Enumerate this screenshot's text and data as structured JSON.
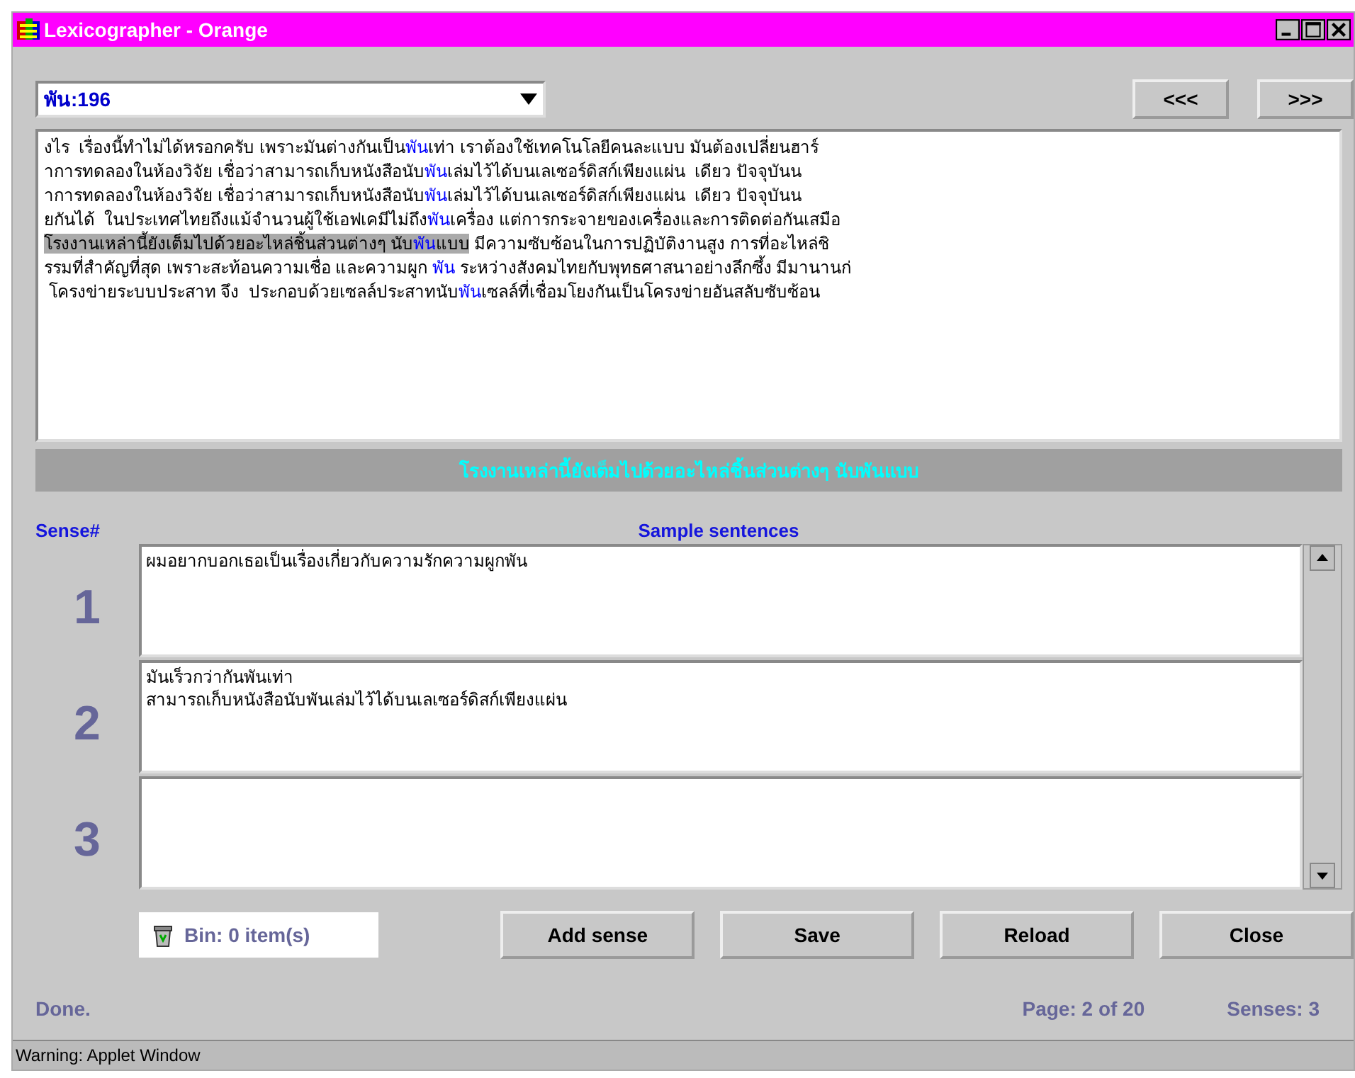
{
  "window": {
    "title": "Lexicographer - Orange"
  },
  "word_selector": {
    "value": "พัน:196"
  },
  "nav_buttons": [
    "<<<",
    ">>>"
  ],
  "concordance": [
    {
      "segments": [
        {
          "text": "งไร  เรื่องนี้ทำไม่ได้หรอกครับ เพราะมันต่างกันเป็น",
          "keyword": false,
          "highlighted": false
        },
        {
          "text": "พัน",
          "keyword": true,
          "highlighted": false
        },
        {
          "text": "เท่า เราต้องใช้เทคโนโลยีคนละแบบ มันต้องเปลี่ยนฮาร์",
          "keyword": false,
          "highlighted": false
        }
      ]
    },
    {
      "segments": [
        {
          "text": "าการทดลองในห้องวิจัย เชื่อว่าสามารถเก็บหนังสือนับ",
          "keyword": false,
          "highlighted": false
        },
        {
          "text": "พัน",
          "keyword": true,
          "highlighted": false
        },
        {
          "text": "เล่มไว้ได้บนเลเซอร์ดิสก์เพียงแผ่น  เดียว ปัจจุบันน",
          "keyword": false,
          "highlighted": false
        }
      ]
    },
    {
      "segments": [
        {
          "text": "าการทดลองในห้องวิจัย เชื่อว่าสามารถเก็บหนังสือนับ",
          "keyword": false,
          "highlighted": false
        },
        {
          "text": "พัน",
          "keyword": true,
          "highlighted": false
        },
        {
          "text": "เล่มไว้ได้บนเลเซอร์ดิสก์เพียงแผ่น  เดียว ปัจจุบันน",
          "keyword": false,
          "highlighted": false
        }
      ]
    },
    {
      "segments": [
        {
          "text": "ยกันได้  ในประเทศไทยถึงแม้จำนวนผู้ใช้เอฟเคมีไม่ถึง",
          "keyword": false,
          "highlighted": false
        },
        {
          "text": "พัน",
          "keyword": true,
          "highlighted": false
        },
        {
          "text": "เครื่อง แต่การกระจายของเครื่องและการติดต่อกันเสมือ",
          "keyword": false,
          "highlighted": false
        }
      ]
    },
    {
      "segments": [
        {
          "text": "โรงงานเหล่านี้ยังเต็มไปด้วยอะไหล่ชิ้นส่วนต่างๆ นับ",
          "keyword": false,
          "highlighted": true
        },
        {
          "text": "พัน",
          "keyword": true,
          "highlighted": true
        },
        {
          "text": "แบบ",
          "keyword": false,
          "highlighted": true
        },
        {
          "text": " มีความซับซ้อนในการปฏิบัติงานสูง การที่อะไหล่ชิ",
          "keyword": false,
          "highlighted": false
        }
      ]
    },
    {
      "segments": [
        {
          "text": "รรมที่สำคัญที่สุด เพราะสะท้อนความเชื่อ และความผูก ",
          "keyword": false,
          "highlighted": false
        },
        {
          "text": "พัน",
          "keyword": true,
          "highlighted": false
        },
        {
          "text": " ระหว่างสังคมไทยกับพุทธศาสนาอย่างลึกซึ้ง มีมานานก่",
          "keyword": false,
          "highlighted": false
        }
      ]
    },
    {
      "segments": [
        {
          "text": " โครงข่ายระบบประสาท จึง  ประกอบด้วยเซลล์ประสาทนับ",
          "keyword": false,
          "highlighted": false
        },
        {
          "text": "พัน",
          "keyword": true,
          "highlighted": false
        },
        {
          "text": "เซลล์ที่เชื่อมโยงกันเป็นโครงข่ายอันสลับซับซ้อน",
          "keyword": false,
          "highlighted": false
        }
      ]
    }
  ],
  "selected_sentence": "โรงงานเหล่านี้ยังเต็มไปด้วยอะไหล่ชิ้นส่วนต่างๆ นับพันแบบ",
  "columns": [
    "Sense#",
    "Sample sentences"
  ],
  "senses": [
    {
      "number": "1",
      "sentences": [
        "ผมอยากบอกเธอเป็นเรื่องเกี่ยวกับความรักความผูกพัน"
      ]
    },
    {
      "number": "2",
      "sentences": [
        "มันเร็วกว่ากันพันเท่า",
        "สามารถเก็บหนังสือนับพันเล่มไว้ได้บนเลเซอร์ดิสก์เพียงแผ่น"
      ]
    },
    {
      "number": "3"
    }
  ],
  "bin": {
    "label": "Bin: 0 item(s)"
  },
  "buttons": [
    "Add sense",
    "Save",
    "Reload",
    "Close"
  ],
  "status": {
    "message": "Done.",
    "page": "Page: 2 of 20",
    "senses": "Senses: 3"
  },
  "warning_bar": "Warning: Applet Window"
}
